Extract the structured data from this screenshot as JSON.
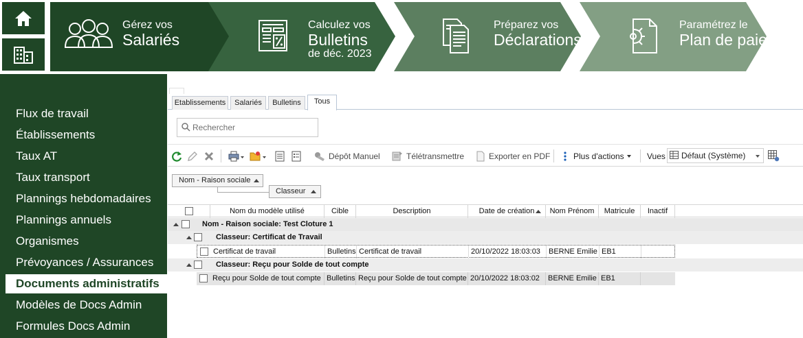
{
  "nav": {
    "home_icon": "home-icon",
    "company_icon": "building-icon"
  },
  "steps": [
    {
      "line1": "Gérez vos",
      "line2": "Salariés",
      "line3": "",
      "icon": "people-icon",
      "color": "#1f4626"
    },
    {
      "line1": "Calculez vos",
      "line2": "Bulletins",
      "line3": "de déc. 2023",
      "icon": "payslip-calculator-icon",
      "color": "#37633f"
    },
    {
      "line1": "Préparez vos",
      "line2": "Déclarations",
      "line3": "",
      "icon": "documents-icon",
      "color": "#5c7f60"
    },
    {
      "line1": "Paramétrez le",
      "line2": "Plan de paie",
      "line3": "",
      "icon": "settings-document-icon",
      "color": "#839f84"
    }
  ],
  "sidebar": {
    "items": [
      {
        "label": "Flux de travail"
      },
      {
        "label": "Établissements"
      },
      {
        "label": "Taux AT"
      },
      {
        "label": "Taux transport"
      },
      {
        "label": "Plannings hebdomadaires"
      },
      {
        "label": "Plannings annuels"
      },
      {
        "label": "Organismes"
      },
      {
        "label": "Prévoyances / Assurances"
      },
      {
        "label": "Documents administratifs",
        "active": true
      },
      {
        "label": "Modèles de Docs Admin"
      },
      {
        "label": "Formules Docs Admin"
      }
    ]
  },
  "tabs": [
    {
      "label": "Etablissements"
    },
    {
      "label": "Salariés"
    },
    {
      "label": "Bulletins"
    },
    {
      "label": "Tous",
      "active": true
    }
  ],
  "search": {
    "placeholder": "Rechercher"
  },
  "toolbar": {
    "depot_label": "Dépôt Manuel",
    "teletransmettre_label": "Télétransmettre",
    "export_label": "Exporter en PDF",
    "more_label": "Plus d'actions",
    "views_label": "Vues",
    "view_value": "Défaut (Système)"
  },
  "grouping": {
    "group1": "Nom - Raison sociale",
    "group2": "Classeur"
  },
  "grid": {
    "columns": [
      "Nom du modèle utilisé",
      "Cible",
      "Description",
      "Date de création",
      "Nom Prénom",
      "Matricule",
      "Inactif"
    ],
    "group_row": "Nom - Raison sociale: Test Cloture 1",
    "subgroups": [
      {
        "label": "Classeur: Certificat de Travail",
        "rows": [
          [
            "Certificat de travail",
            "Bulletins",
            "Certificat de travail",
            "20/10/2022 18:03:03",
            "BERNE Emilie",
            "EB1",
            ""
          ]
        ]
      },
      {
        "label": "Classeur: Reçu pour Solde de tout compte",
        "rows": [
          [
            "Reçu pour Solde de tout compte",
            "Bulletins",
            "Reçu pour Solde de tout compte",
            "20/10/2022 18:03:02",
            "BERNE Emilie",
            "EB1",
            ""
          ]
        ]
      }
    ]
  }
}
